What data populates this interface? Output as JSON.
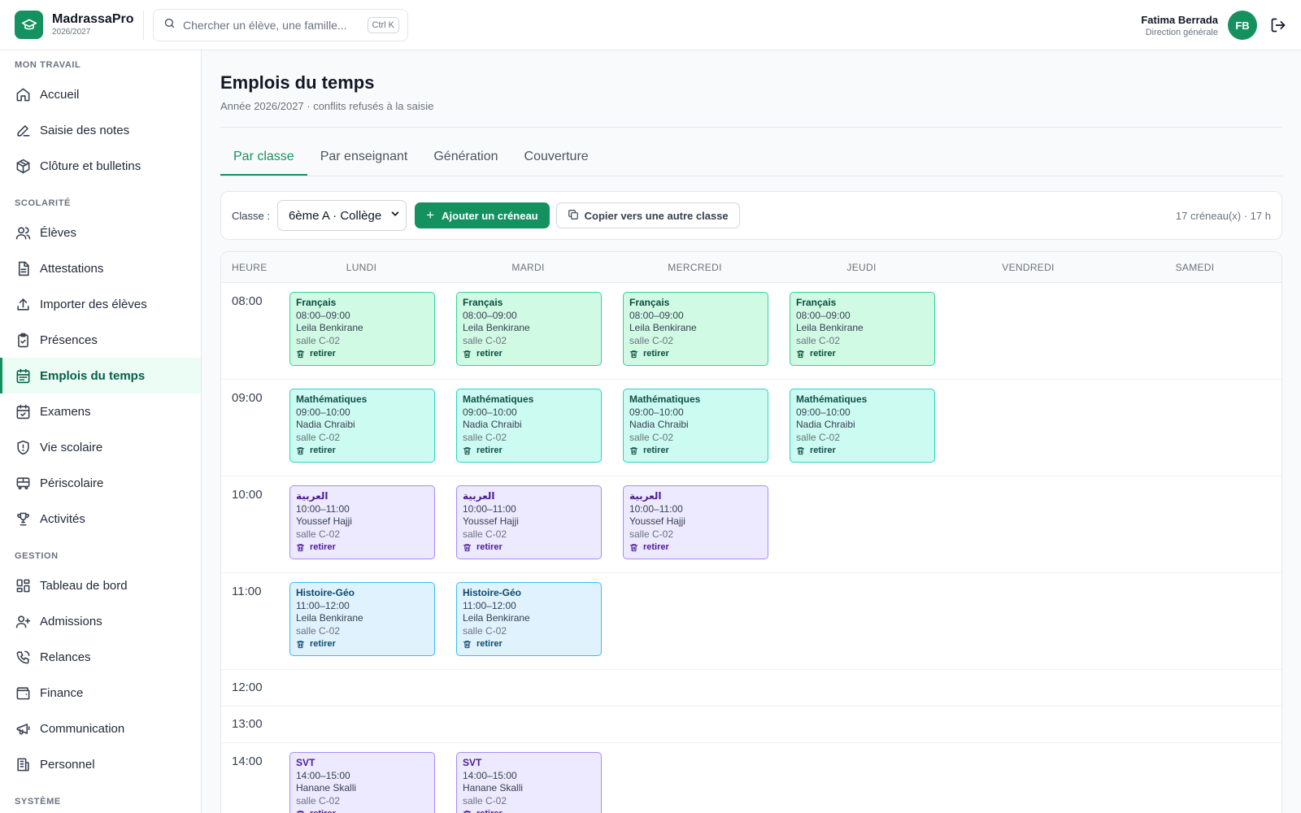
{
  "app": {
    "name": "MadrassaPro",
    "year": "2026/2027"
  },
  "search": {
    "placeholder": "Chercher un élève, une famille...",
    "shortcut": "Ctrl K"
  },
  "user": {
    "name": "Fatima Berrada",
    "role": "Direction générale",
    "initials": "FB"
  },
  "sidebar": {
    "sections": [
      {
        "label": "MON TRAVAIL",
        "items": [
          {
            "label": "Accueil",
            "icon": "home-icon"
          },
          {
            "label": "Saisie des notes",
            "icon": "pencil-icon"
          },
          {
            "label": "Clôture et bulletins",
            "icon": "package-icon"
          }
        ]
      },
      {
        "label": "SCOLARITÉ",
        "items": [
          {
            "label": "Élèves",
            "icon": "users-icon"
          },
          {
            "label": "Attestations",
            "icon": "document-icon"
          },
          {
            "label": "Importer des élèves",
            "icon": "upload-icon"
          },
          {
            "label": "Présences",
            "icon": "clipboard-icon"
          },
          {
            "label": "Emplois du temps",
            "icon": "calendar-icon",
            "active": true
          },
          {
            "label": "Examens",
            "icon": "calendar-check-icon"
          },
          {
            "label": "Vie scolaire",
            "icon": "shield-icon"
          },
          {
            "label": "Périscolaire",
            "icon": "bus-icon"
          },
          {
            "label": "Activités",
            "icon": "trophy-icon"
          }
        ]
      },
      {
        "label": "GESTION",
        "items": [
          {
            "label": "Tableau de bord",
            "icon": "dashboard-icon"
          },
          {
            "label": "Admissions",
            "icon": "user-plus-icon"
          },
          {
            "label": "Relances",
            "icon": "phone-icon"
          },
          {
            "label": "Finance",
            "icon": "wallet-icon"
          },
          {
            "label": "Communication",
            "icon": "megaphone-icon"
          },
          {
            "label": "Personnel",
            "icon": "building-icon"
          }
        ]
      },
      {
        "label": "SYSTÈME",
        "items": []
      }
    ]
  },
  "page": {
    "title": "Emplois du temps",
    "subtitle": "Année 2026/2027 · conflits refusés à la saisie",
    "tabs": [
      "Par classe",
      "Par enseignant",
      "Génération",
      "Couverture"
    ],
    "active_tab": 0
  },
  "toolbar": {
    "class_label": "Classe :",
    "class_value": "6ème A · Collège",
    "add_label": "Ajouter un créneau",
    "copy_label": "Copier vers une autre classe",
    "count": "17 créneau(x) · 17 h"
  },
  "timetable": {
    "hour_header": "HEURE",
    "days": [
      "LUNDI",
      "MARDI",
      "MERCREDI",
      "JEUDI",
      "VENDREDI",
      "SAMEDI"
    ],
    "remove_label": "retirer",
    "colors": {
      "francais": "#d1fae5",
      "maths": "#ccfbf1",
      "arabe": "#ede9fe",
      "histoire": "#e0f2fe",
      "svt": "#ede9fe",
      "accent": "#15915f"
    },
    "rows": [
      {
        "hour": "08:00",
        "slots": [
          {
            "subject": "Français",
            "time": "08:00–09:00",
            "teacher": "Leila Benkirane",
            "room": "salle C-02",
            "color": "fr"
          },
          {
            "subject": "Français",
            "time": "08:00–09:00",
            "teacher": "Leila Benkirane",
            "room": "salle C-02",
            "color": "fr"
          },
          {
            "subject": "Français",
            "time": "08:00–09:00",
            "teacher": "Leila Benkirane",
            "room": "salle C-02",
            "color": "fr"
          },
          {
            "subject": "Français",
            "time": "08:00–09:00",
            "teacher": "Leila Benkirane",
            "room": "salle C-02",
            "color": "fr"
          },
          null,
          null
        ]
      },
      {
        "hour": "09:00",
        "slots": [
          {
            "subject": "Mathématiques",
            "time": "09:00–10:00",
            "teacher": "Nadia Chraibi",
            "room": "salle C-02",
            "color": "ma"
          },
          {
            "subject": "Mathématiques",
            "time": "09:00–10:00",
            "teacher": "Nadia Chraibi",
            "room": "salle C-02",
            "color": "ma"
          },
          {
            "subject": "Mathématiques",
            "time": "09:00–10:00",
            "teacher": "Nadia Chraibi",
            "room": "salle C-02",
            "color": "ma"
          },
          {
            "subject": "Mathématiques",
            "time": "09:00–10:00",
            "teacher": "Nadia Chraibi",
            "room": "salle C-02",
            "color": "ma"
          },
          null,
          null
        ]
      },
      {
        "hour": "10:00",
        "slots": [
          {
            "subject": "العربية",
            "time": "10:00–11:00",
            "teacher": "Youssef Hajji",
            "room": "salle C-02",
            "color": "ar"
          },
          {
            "subject": "العربية",
            "time": "10:00–11:00",
            "teacher": "Youssef Hajji",
            "room": "salle C-02",
            "color": "ar"
          },
          {
            "subject": "العربية",
            "time": "10:00–11:00",
            "teacher": "Youssef Hajji",
            "room": "salle C-02",
            "color": "ar"
          },
          null,
          null,
          null
        ]
      },
      {
        "hour": "11:00",
        "slots": [
          {
            "subject": "Histoire-Géo",
            "time": "11:00–12:00",
            "teacher": "Leila Benkirane",
            "room": "salle C-02",
            "color": "hg"
          },
          {
            "subject": "Histoire-Géo",
            "time": "11:00–12:00",
            "teacher": "Leila Benkirane",
            "room": "salle C-02",
            "color": "hg"
          },
          null,
          null,
          null,
          null
        ]
      },
      {
        "hour": "12:00",
        "slots": [
          null,
          null,
          null,
          null,
          null,
          null
        ]
      },
      {
        "hour": "13:00",
        "slots": [
          null,
          null,
          null,
          null,
          null,
          null
        ]
      },
      {
        "hour": "14:00",
        "slots": [
          {
            "subject": "SVT",
            "time": "14:00–15:00",
            "teacher": "Hanane Skalli",
            "room": "salle C-02",
            "color": "sv"
          },
          {
            "subject": "SVT",
            "time": "14:00–15:00",
            "teacher": "Hanane Skalli",
            "room": "salle C-02",
            "color": "sv"
          },
          null,
          null,
          null,
          null
        ]
      }
    ]
  }
}
